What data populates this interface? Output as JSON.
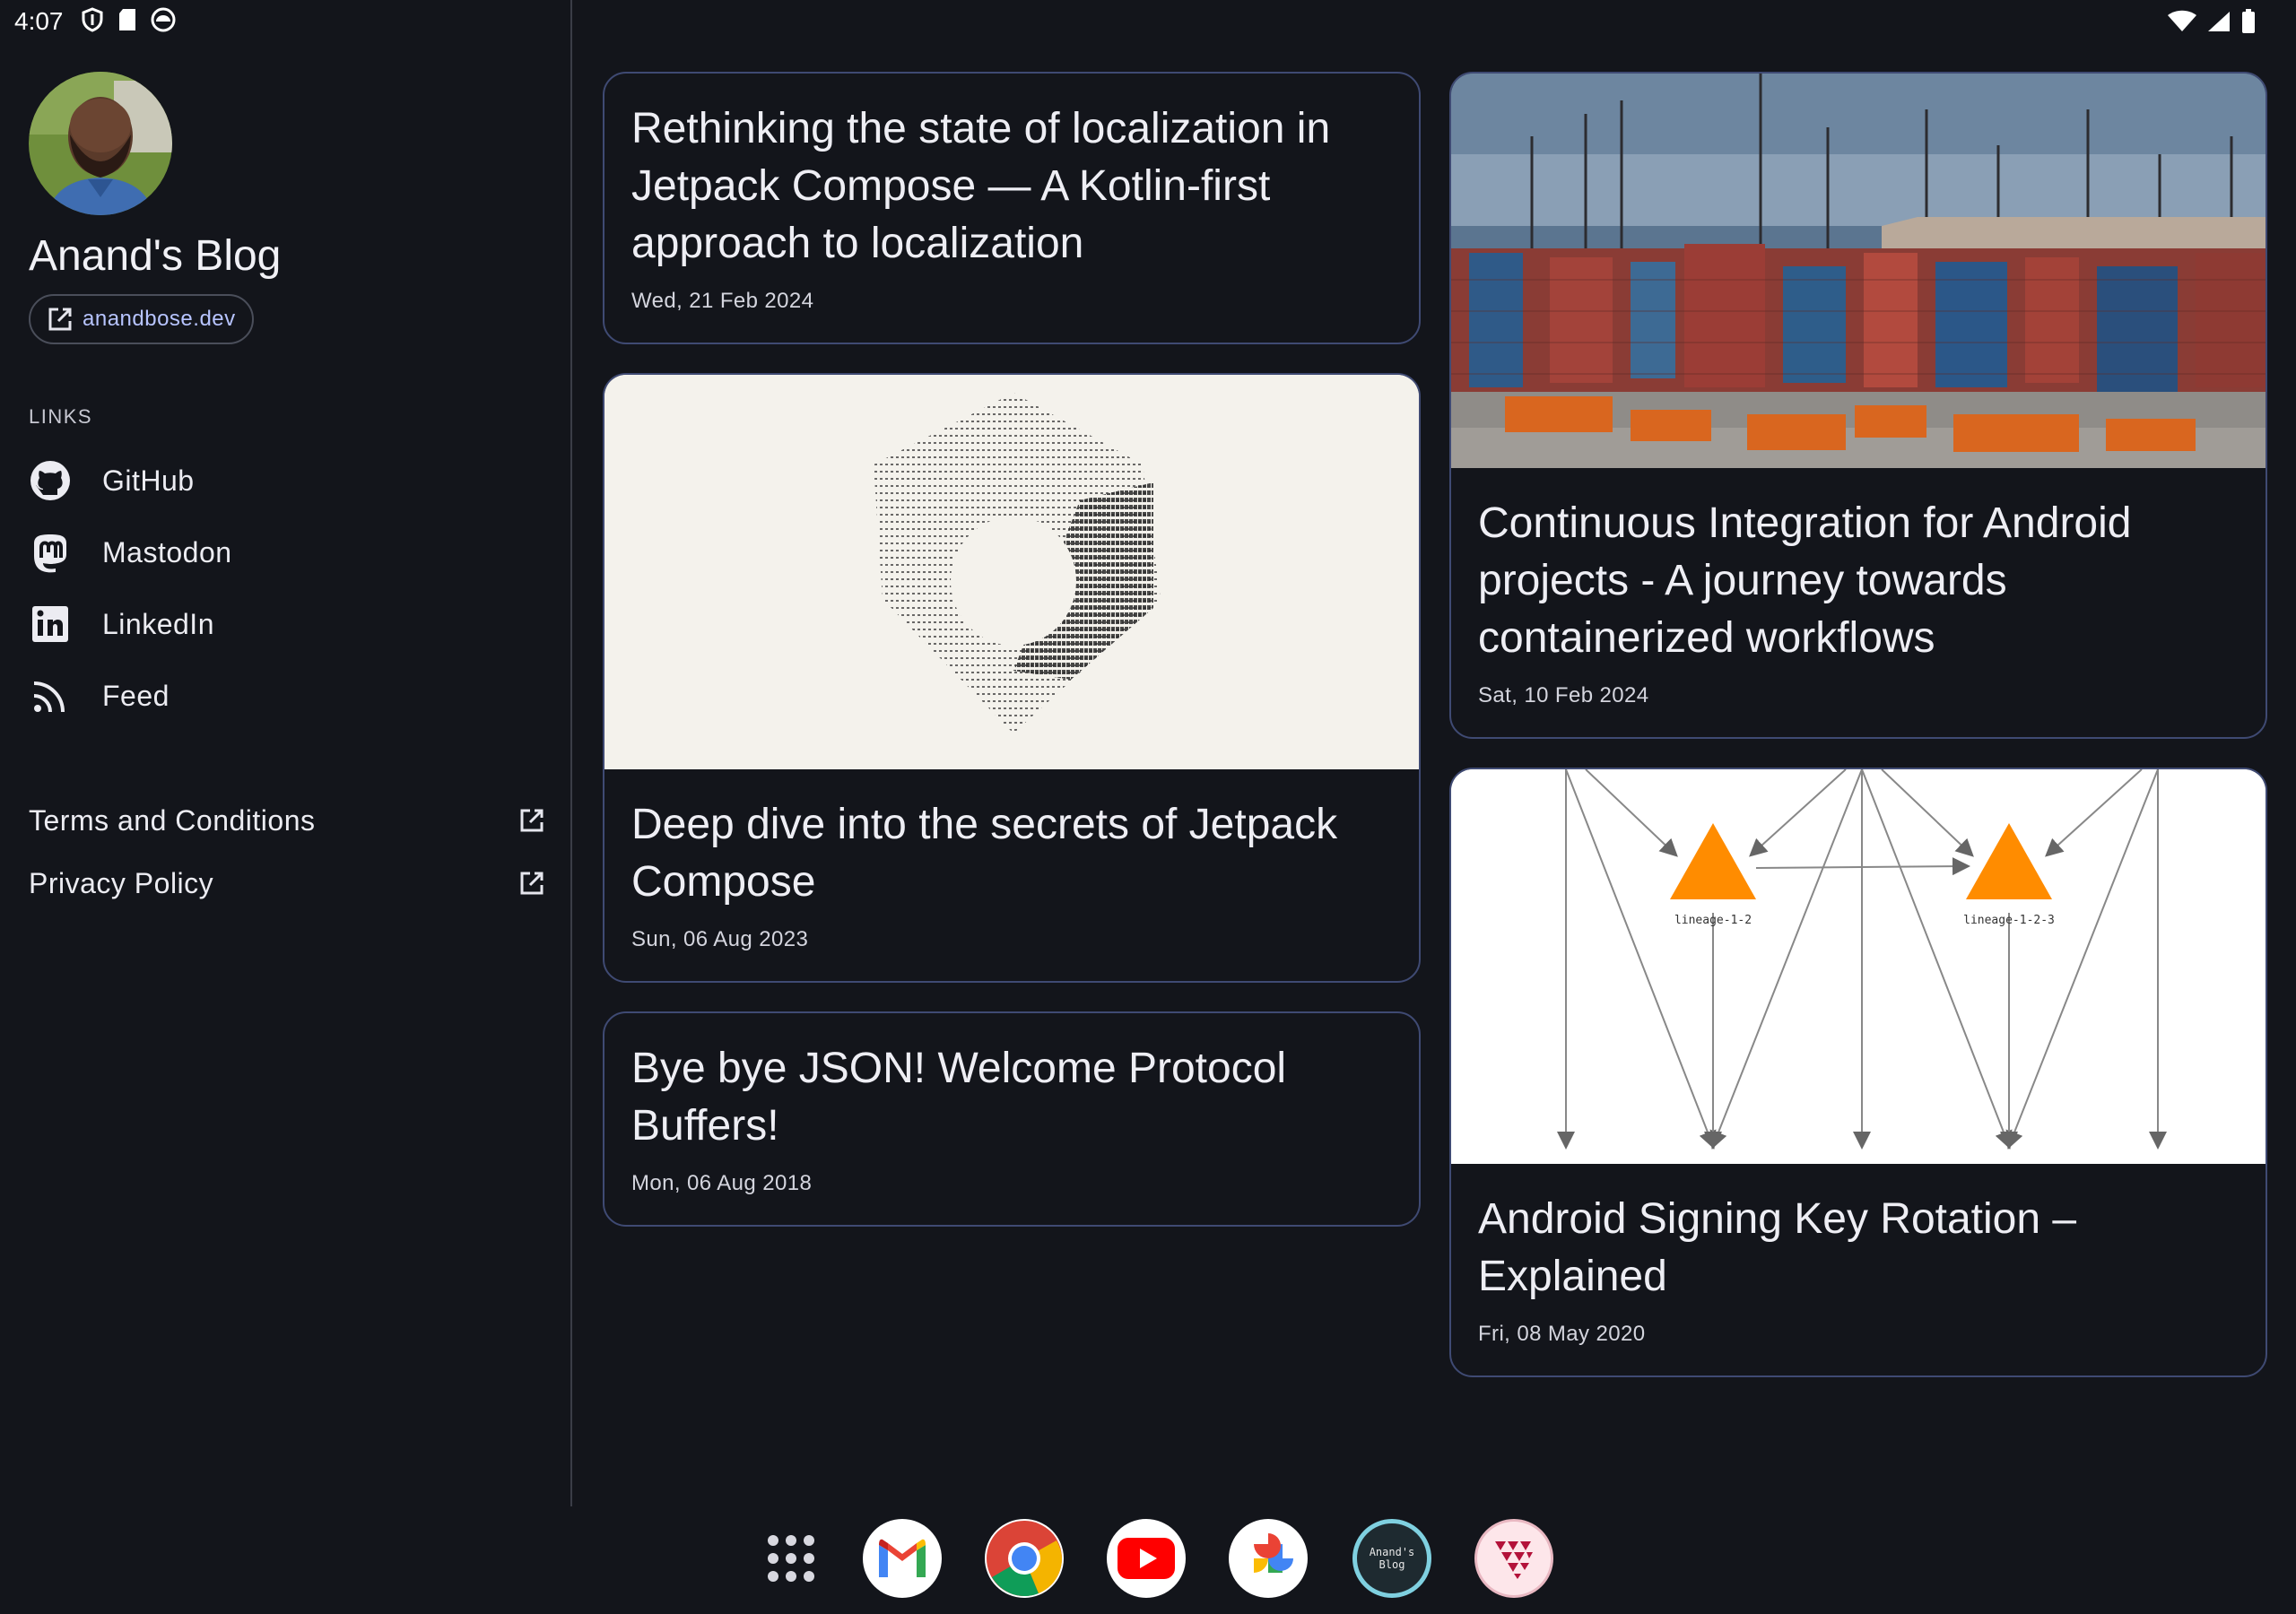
{
  "status_bar": {
    "time": "4:07",
    "left_icons": [
      "shield-icon",
      "sd-card-icon",
      "android-robot-icon"
    ],
    "right_icons": [
      "wifi-icon",
      "cell-signal-icon",
      "battery-icon"
    ]
  },
  "sidebar": {
    "avatar_icon": "profile-photo",
    "blog_title": "Anand's Blog",
    "site_link": "anandbose.dev",
    "links_header": "LINKS",
    "links": [
      {
        "label": "GitHub",
        "icon": "github-icon"
      },
      {
        "label": "Mastodon",
        "icon": "mastodon-icon"
      },
      {
        "label": "LinkedIn",
        "icon": "linkedin-icon"
      },
      {
        "label": "Feed",
        "icon": "rss-feed-icon"
      }
    ],
    "legal": [
      {
        "label": "Terms and Conditions",
        "icon": "open-external-icon"
      },
      {
        "label": "Privacy Policy",
        "icon": "open-external-icon"
      }
    ]
  },
  "posts": [
    {
      "title": "Rethinking the state of localization in Jetpack Compose — A Kotlin-first approach to localization",
      "date": "Wed, 21 Feb 2024",
      "has_image": false
    },
    {
      "title": "Continuous Integration for Android projects - A journey towards containerized workflows",
      "date": "Sat, 10 Feb 2024",
      "image": "shipping-container-yard-photo"
    },
    {
      "title": "Deep dive into the secrets of Jetpack Compose",
      "date": "Sun, 06 Aug 2023",
      "image": "ascii-art-compose-logo"
    },
    {
      "title": "Android Signing Key Rotation – Explained",
      "date": "Fri, 08 May 2020",
      "image": "lineage-diagram",
      "diagram_labels": [
        "lineage-1-2",
        "lineage-1-2-3"
      ]
    },
    {
      "title": "Bye bye JSON! Welcome Protocol Buffers!",
      "date": "Mon, 06 Aug 2018",
      "has_image": false
    }
  ],
  "dock": {
    "apps": [
      "app-drawer-icon",
      "gmail-icon",
      "chrome-icon",
      "youtube-icon",
      "photos-icon",
      "anands-blog-app-icon",
      "app-icon"
    ],
    "blog_app_label": "Anand's Blog"
  },
  "colors": {
    "background": "#13151b",
    "card_border": "#3f4a73",
    "link_accent": "#b7c4ff",
    "triangle": "#ff8c00"
  }
}
